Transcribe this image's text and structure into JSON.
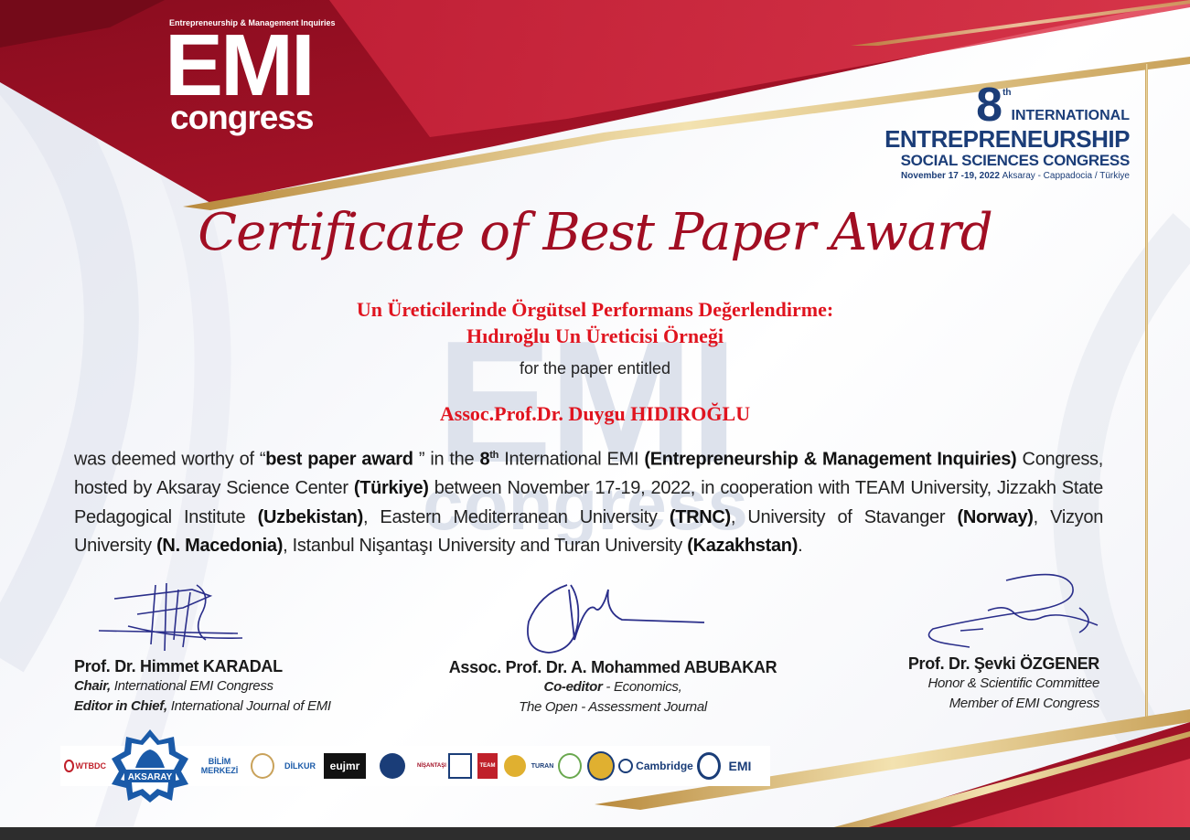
{
  "header": {
    "brand_tagline": "Entrepreneurship & Management Inquiries",
    "brand_main": "EMI",
    "brand_sub": "congress",
    "event_number": "8",
    "event_number_suffix": "th",
    "event_line1": "INTERNATIONAL",
    "event_line2": "ENTREPRENEURSHIP",
    "event_line3": "SOCIAL SCIENCES CONGRESS",
    "event_dates": "November 17 -19, 2022",
    "event_location": "Aksaray - Cappadocia / Türkiye"
  },
  "watermark": {
    "main": "EMI",
    "sub": "congress"
  },
  "certificate": {
    "title": "Certificate of Best Paper Award",
    "paper_title_line1": "Un Üreticilerinde Örgütsel Performans Değerlendirme:",
    "paper_title_line2": "Hıdıroğlu Un Üreticisi Örneği",
    "entitled_text": "for the paper entitled",
    "recipient": "Assoc.Prof.Dr. Duygu HIDIROĞLU",
    "body": {
      "t1": "was deemed worthy of “",
      "award": "best paper award",
      "t2": "” in the",
      "ordinal": "8",
      "ordinal_suffix": "th",
      "t3": "International EMI",
      "emi_full": "(Entrepreneurship & Management Inquiries)",
      "t4": "Congress, hosted by Aksaray Science Center",
      "c1": "(Türkiye)",
      "t5": "between November 17-19, 2022, in cooperation with TEAM University, Jizzakh State Pedagogical Institute",
      "c2": "(Uzbekistan)",
      "t6": ", Eastern Mediterranean University",
      "c3": "(TRNC)",
      "t7": ", University of Stavanger",
      "c4": "(Norway)",
      "t8": ", Vizyon University",
      "c5": "(N. Macedonia)",
      "t9": ", Istanbul Nişantaşı University and Turan University",
      "c6": "(Kazakhstan)",
      "t10": "."
    }
  },
  "signatories": [
    {
      "name": "Prof. Dr. Himmet KARADAL",
      "role1_bold": "Chair,",
      "role1": "International EMI Congress",
      "role2_bold": "Editor in Chief,",
      "role2": "International Journal of EMI"
    },
    {
      "name": "Assoc. Prof. Dr. A. Mohammed ABUBAKAR",
      "role1_bold": "Co-editor",
      "role1": "-  Economics,",
      "role2": "The Open - Assessment Journal"
    },
    {
      "name": "Prof. Dr. Şevki ÖZGENER",
      "role1": "Honor & Scientific Committee",
      "role2": "Member of EMI Congress"
    }
  ],
  "sponsors": {
    "wtbdc": "WTBDC",
    "aksaray": "AKSARAY",
    "bilim_line1": "BİLİM",
    "bilim_line2": "MERKEZİ",
    "dilkur": "DİLKUR",
    "eujmr": "eujmr",
    "nisantasi": "NİŞANTAŞI",
    "team": "TEAM",
    "turan": "TURAN",
    "cambridge": "Cambridge",
    "emi_journal": "EMI"
  },
  "colors": {
    "crimson": "#9c0f25",
    "red_text": "#e0141f",
    "gold": "#c9a25a",
    "navy": "#1b3d78"
  }
}
